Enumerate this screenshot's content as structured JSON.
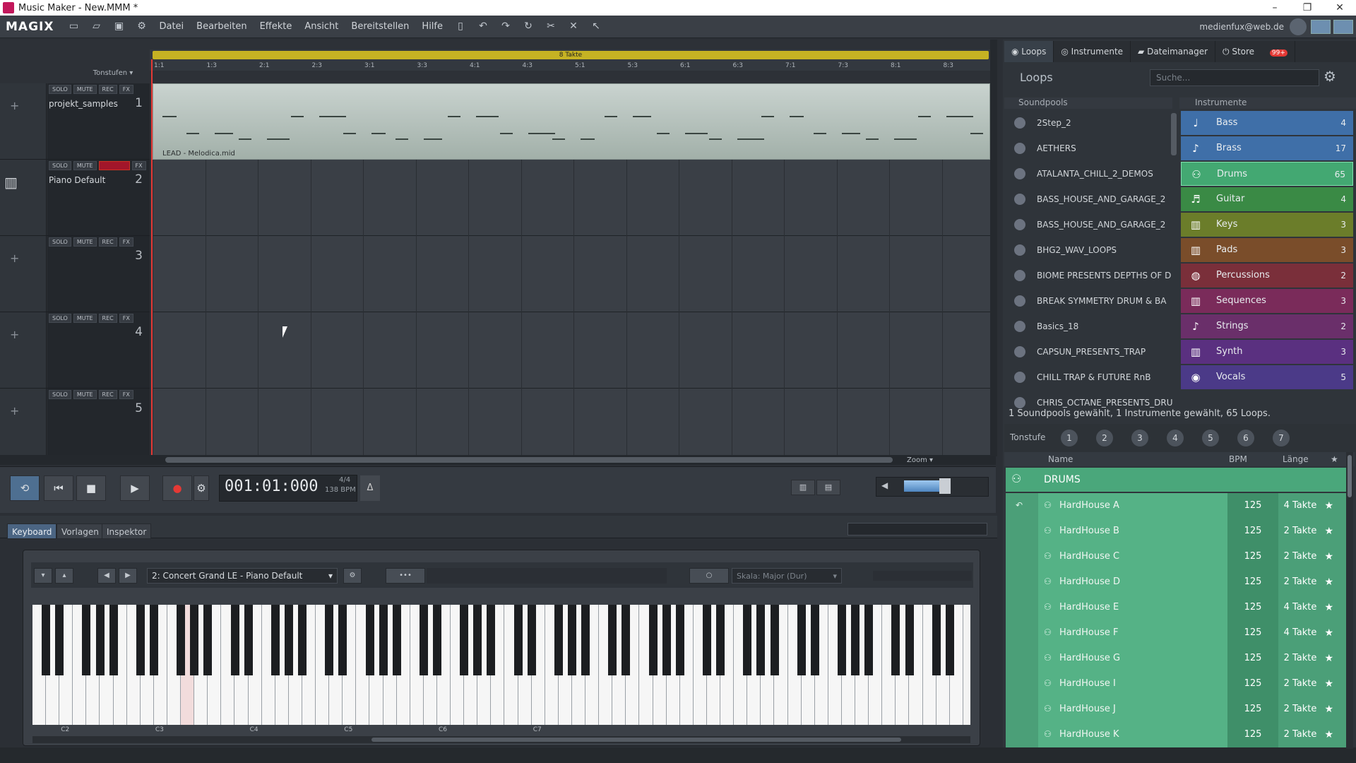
{
  "titlebar": {
    "title": "Music Maker - New.MMM *"
  },
  "menubar": {
    "brand": "MAGIX",
    "items": [
      "Datei",
      "Bearbeiten",
      "Effekte",
      "Ansicht",
      "Bereitstellen",
      "Hilfe"
    ],
    "user": "medienfux@web.de"
  },
  "arranger": {
    "loop_label": "8 Takte",
    "tonstufen": "Tonstufen",
    "ticks": [
      "1:1",
      "1:3",
      "2:1",
      "2:3",
      "3:1",
      "3:3",
      "4:1",
      "4:3",
      "5:1",
      "5:3",
      "6:1",
      "6:3",
      "7:1",
      "7:3",
      "8:1",
      "8:3"
    ],
    "clip_label": "LEAD - Melodica.mid",
    "tracks": [
      {
        "name": "projekt_samples",
        "num": "1",
        "solo": "SOLO",
        "mute": "MUTE",
        "rec": "REC",
        "fx": "FX"
      },
      {
        "name": "Piano Default",
        "num": "2",
        "solo": "SOLO",
        "mute": "MUTE",
        "rec": "",
        "fx": "FX"
      },
      {
        "name": "",
        "num": "3",
        "solo": "SOLO",
        "mute": "MUTE",
        "rec": "REC",
        "fx": "FX"
      },
      {
        "name": "",
        "num": "4",
        "solo": "SOLO",
        "mute": "MUTE",
        "rec": "REC",
        "fx": "FX"
      },
      {
        "name": "",
        "num": "5",
        "solo": "SOLO",
        "mute": "MUTE",
        "rec": "REC",
        "fx": "FX"
      }
    ],
    "zoom": "Zoom"
  },
  "transport": {
    "time": "001:01:000",
    "timesig": "4/4",
    "bpm": "138 BPM"
  },
  "lower": {
    "tabs": [
      "Keyboard",
      "Vorlagen",
      "Inspektor"
    ],
    "instrument": "2: Concert Grand LE - Piano Default",
    "skala": "Skala: Major (Dur)",
    "octave_labels": [
      "C2",
      "C3",
      "C4",
      "C5",
      "C6",
      "C7"
    ]
  },
  "right": {
    "tabs": [
      "Loops",
      "Instrumente",
      "Dateimanager",
      "Store"
    ],
    "store_badge": "99+",
    "title": "Loops",
    "search_placeholder": "Suche...",
    "soundpools_header": "Soundpools",
    "instruments_header": "Instrumente",
    "soundpools": [
      "2Step_2",
      "AETHERS",
      "ATALANTA_CHILL_2_DEMOS",
      "BASS_HOUSE_AND_GARAGE_2",
      "BASS_HOUSE_AND_GARAGE_2",
      "BHG2_WAV_LOOPS",
      "BIOME PRESENTS DEPTHS OF D",
      "BREAK SYMMETRY DRUM & BA",
      "Basics_18",
      "CAPSUN_PRESENTS_TRAP",
      "CHILL TRAP & FUTURE RnB",
      "CHRIS_OCTANE_PRESENTS_DRU"
    ],
    "instruments": [
      {
        "name": "Bass",
        "count": "4",
        "color": "#3f6fa8"
      },
      {
        "name": "Brass",
        "count": "17",
        "color": "#3f6fa8"
      },
      {
        "name": "Drums",
        "count": "65",
        "color": "#43a872"
      },
      {
        "name": "Guitar",
        "count": "4",
        "color": "#3a8a45"
      },
      {
        "name": "Keys",
        "count": "3",
        "color": "#6b7d2a"
      },
      {
        "name": "Pads",
        "count": "3",
        "color": "#7a4d2a"
      },
      {
        "name": "Percussions",
        "count": "2",
        "color": "#7a2f3a"
      },
      {
        "name": "Sequences",
        "count": "3",
        "color": "#7a2b5a"
      },
      {
        "name": "Strings",
        "count": "2",
        "color": "#6a2f6a"
      },
      {
        "name": "Synth",
        "count": "3",
        "color": "#5a3080"
      },
      {
        "name": "Vocals",
        "count": "5",
        "color": "#4b3a88"
      }
    ],
    "selection_info": "1 Soundpools gewählt, 1 Instrumente gewählt, 65 Loops.",
    "tonstufe_label": "Tonstufe",
    "tonstufe_buttons": [
      "1",
      "2",
      "3",
      "4",
      "5",
      "6",
      "7"
    ],
    "list_headers": {
      "name": "Name",
      "bpm": "BPM",
      "length": "Länge"
    },
    "group": "DRUMS",
    "loops": [
      {
        "name": "HardHouse A",
        "bpm": "125",
        "length": "4 Takte"
      },
      {
        "name": "HardHouse B",
        "bpm": "125",
        "length": "2 Takte"
      },
      {
        "name": "HardHouse C",
        "bpm": "125",
        "length": "2 Takte"
      },
      {
        "name": "HardHouse D",
        "bpm": "125",
        "length": "2 Takte"
      },
      {
        "name": "HardHouse E",
        "bpm": "125",
        "length": "4 Takte"
      },
      {
        "name": "HardHouse F",
        "bpm": "125",
        "length": "4 Takte"
      },
      {
        "name": "HardHouse G",
        "bpm": "125",
        "length": "2 Takte"
      },
      {
        "name": "HardHouse I",
        "bpm": "125",
        "length": "2 Takte"
      },
      {
        "name": "HardHouse J",
        "bpm": "125",
        "length": "2 Takte"
      },
      {
        "name": "HardHouse K",
        "bpm": "125",
        "length": "2 Takte"
      }
    ]
  }
}
